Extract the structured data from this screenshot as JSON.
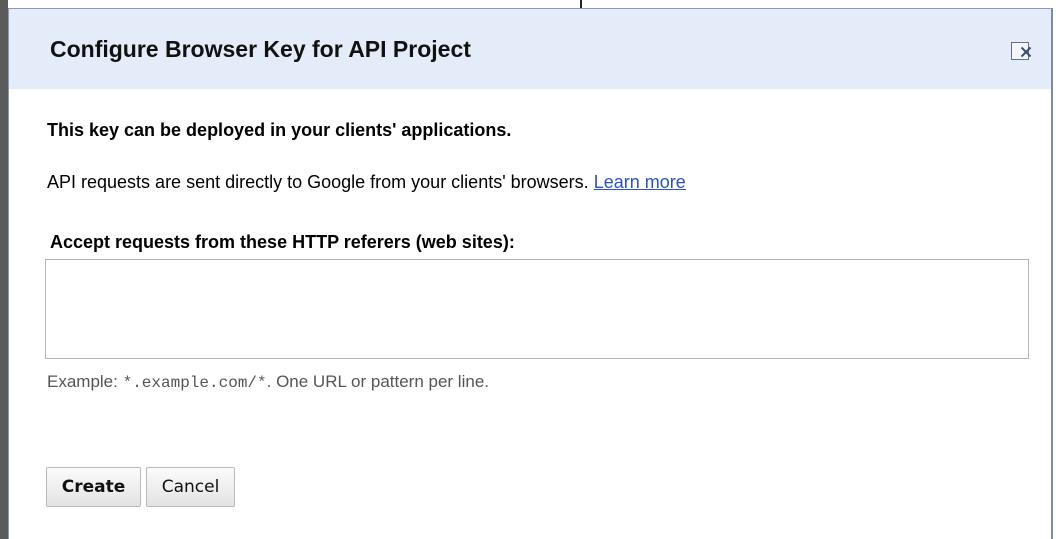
{
  "dialog": {
    "title": "Configure Browser Key for API Project",
    "close_icon": "close-icon"
  },
  "content": {
    "heading": "This key can be deployed in your clients' applications.",
    "description": "API requests are sent directly to Google from your clients' browsers.",
    "learn_more": "Learn more",
    "field_label": "Accept requests from these HTTP referers (web sites):",
    "referers_value": "",
    "hint_prefix": "Example: ",
    "hint_code": "*.example.com/*",
    "hint_suffix": ". One URL or pattern per line."
  },
  "buttons": {
    "create": "Create",
    "cancel": "Cancel"
  },
  "colors": {
    "titlebar_bg": "#e5ecf9",
    "link": "#2b50c8",
    "hint_text": "#555555"
  }
}
